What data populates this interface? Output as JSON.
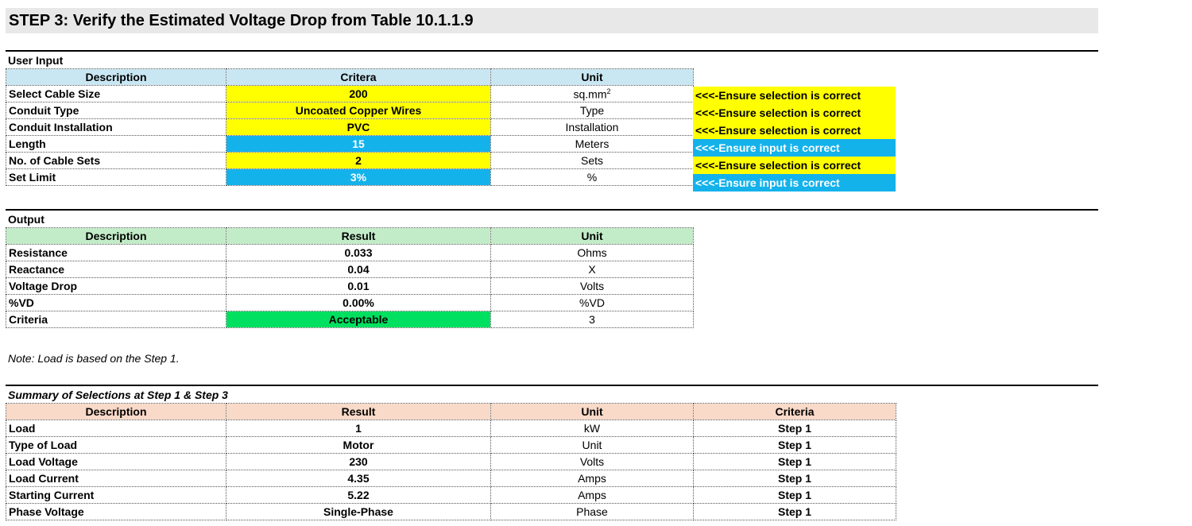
{
  "title": "STEP 3: Verify the Estimated Voltage Drop from Table 10.1.1.9",
  "user_input": {
    "label": "User Input",
    "headers": {
      "description": "Description",
      "criteria": "Critera",
      "unit": "Unit"
    },
    "rows": [
      {
        "description": "Select Cable Size",
        "value": "200",
        "unit": "sq.mm",
        "unit_sup": "2",
        "note": "<<<-Ensure selection is correct",
        "kind": "selection"
      },
      {
        "description": "Conduit Type",
        "value": "Uncoated Copper Wires",
        "unit": "Type",
        "unit_sup": "",
        "note": "<<<-Ensure selection is correct",
        "kind": "selection"
      },
      {
        "description": "Conduit Installation",
        "value": "PVC",
        "unit": "Installation",
        "unit_sup": "",
        "note": "<<<-Ensure selection is correct",
        "kind": "selection"
      },
      {
        "description": "Length",
        "value": "15",
        "unit": "Meters",
        "unit_sup": "",
        "note": "<<<-Ensure input is correct",
        "kind": "input"
      },
      {
        "description": "No. of Cable Sets",
        "value": "2",
        "unit": "Sets",
        "unit_sup": "",
        "note": "<<<-Ensure selection is correct",
        "kind": "selection"
      },
      {
        "description": "Set Limit",
        "value": "3%",
        "unit": "%",
        "unit_sup": "",
        "note": "<<<-Ensure input is correct",
        "kind": "input"
      }
    ],
    "colors": {
      "selection": "#ffff00",
      "input": "#14b2eb"
    }
  },
  "output": {
    "label": "Output",
    "headers": {
      "description": "Description",
      "result": "Result",
      "unit": "Unit"
    },
    "rows": [
      {
        "description": "Resistance",
        "value": "0.033",
        "unit": "Ohms"
      },
      {
        "description": "Reactance",
        "value": "0.04",
        "unit": "X"
      },
      {
        "description": "Voltage Drop",
        "value": "0.01",
        "unit": "Volts"
      },
      {
        "description": "%VD",
        "value": "0.00%",
        "unit": "%VD"
      },
      {
        "description": "Criteria",
        "value": "Acceptable",
        "unit": "3",
        "status_color": "#00e060"
      }
    ]
  },
  "note": "Note: Load is based on the Step 1.",
  "summary": {
    "label": "Summary of Selections at Step 1 & Step 3",
    "headers": {
      "description": "Description",
      "result": "Result",
      "unit": "Unit",
      "criteria": "Criteria"
    },
    "rows": [
      {
        "description": "Load",
        "value": "1",
        "unit": "kW",
        "criteria": "Step 1"
      },
      {
        "description": "Type of Load",
        "value": "Motor",
        "unit": "Unit",
        "criteria": "Step 1"
      },
      {
        "description": "Load Voltage",
        "value": "230",
        "unit": "Volts",
        "criteria": "Step 1"
      },
      {
        "description": "Load Current",
        "value": "4.35",
        "unit": "Amps",
        "criteria": "Step 1"
      },
      {
        "description": "Starting Current",
        "value": "5.22",
        "unit": "Amps",
        "criteria": "Step 1"
      },
      {
        "description": "Phase Voltage",
        "value": "Single-Phase",
        "unit": "Phase",
        "criteria": "Step 1"
      }
    ]
  }
}
